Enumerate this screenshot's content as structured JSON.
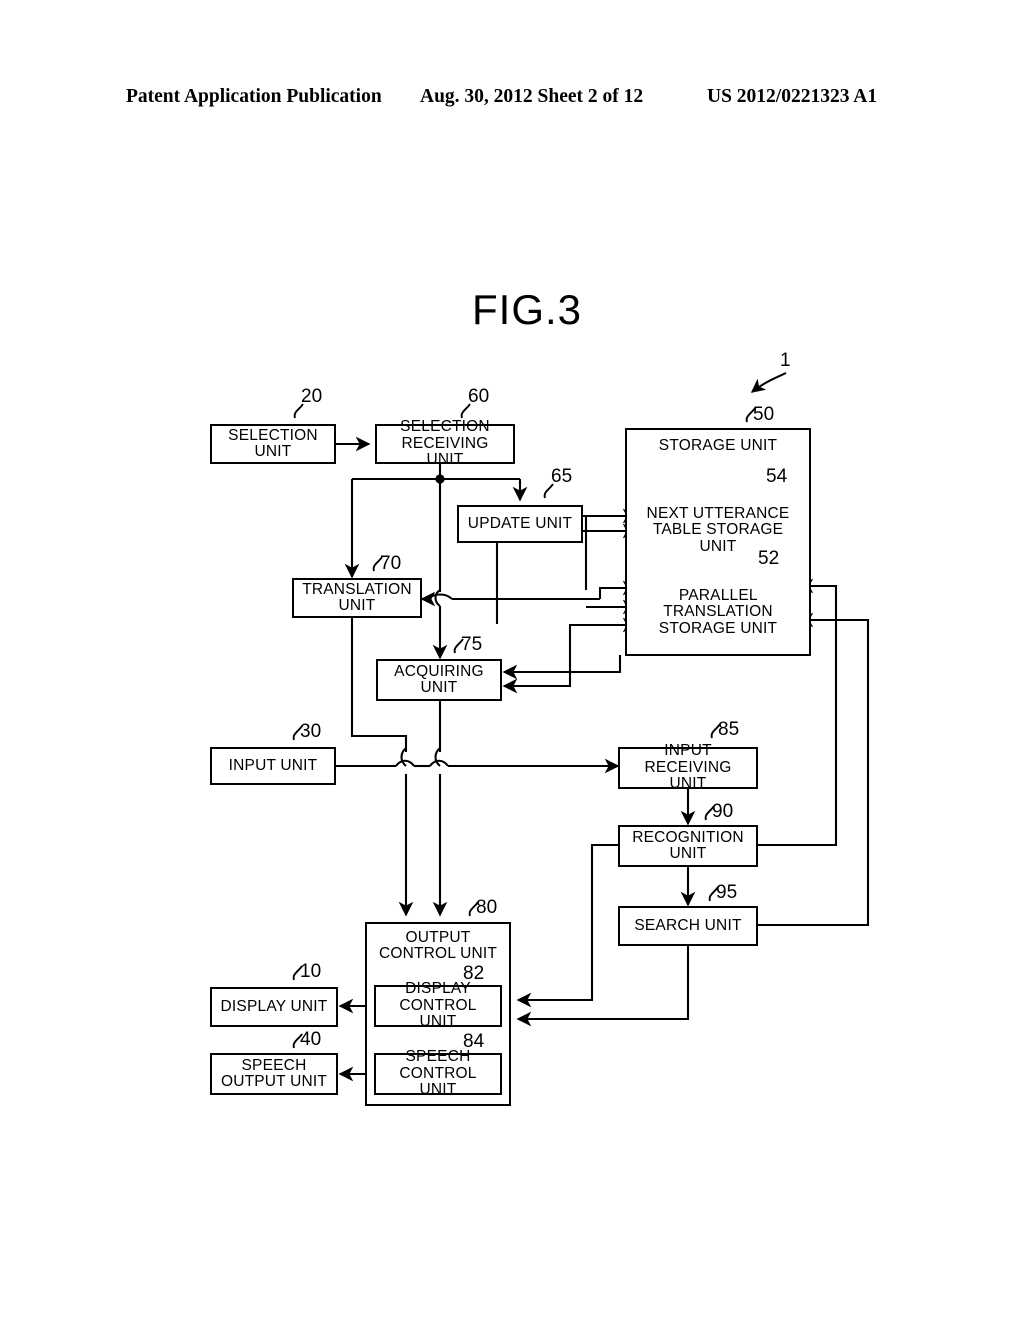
{
  "header": {
    "publication": "Patent Application Publication",
    "date_sheet": "Aug. 30, 2012  Sheet 2 of 12",
    "patent_number": "US 2012/0221323 A1"
  },
  "figure": {
    "title": "FIG.3",
    "system_ref": "1"
  },
  "nodes": [
    {
      "id": "selection_unit",
      "label": "SELECTION\nUNIT",
      "ref": "20"
    },
    {
      "id": "selection_receiving_unit",
      "label": "SELECTION\nRECEIVING UNIT",
      "ref": "60"
    },
    {
      "id": "update_unit",
      "label": "UPDATE UNIT",
      "ref": "65"
    },
    {
      "id": "storage_unit",
      "label": "STORAGE UNIT",
      "ref": "50"
    },
    {
      "id": "next_utterance_table",
      "label": "NEXT UTTERANCE\nTABLE STORAGE\nUNIT",
      "ref": "54"
    },
    {
      "id": "parallel_translation",
      "label": "PARALLEL\nTRANSLATION\nSTORAGE UNIT",
      "ref": "52"
    },
    {
      "id": "translation_unit",
      "label": "TRANSLATION\nUNIT",
      "ref": "70"
    },
    {
      "id": "acquiring_unit",
      "label": "ACQUIRING\nUNIT",
      "ref": "75"
    },
    {
      "id": "input_unit",
      "label": "INPUT UNIT",
      "ref": "30"
    },
    {
      "id": "input_receiving_unit",
      "label": "INPUT\nRECEIVING UNIT",
      "ref": "85"
    },
    {
      "id": "recognition_unit",
      "label": "RECOGNITION\nUNIT",
      "ref": "90"
    },
    {
      "id": "search_unit",
      "label": "SEARCH UNIT",
      "ref": "95"
    },
    {
      "id": "output_control_unit",
      "label": "OUTPUT\nCONTROL UNIT",
      "ref": "80"
    },
    {
      "id": "display_control_unit",
      "label": "DISPLAY\nCONTROL UNIT",
      "ref": "82"
    },
    {
      "id": "speech_control_unit",
      "label": "SPEECH\nCONTROL UNIT",
      "ref": "84"
    },
    {
      "id": "display_unit",
      "label": "DISPLAY UNIT",
      "ref": "10"
    },
    {
      "id": "speech_output_unit",
      "label": "SPEECH\nOUTPUT UNIT",
      "ref": "40"
    }
  ],
  "labels": {
    "selection_unit": "SELECTION\nUNIT",
    "selection_unit_l1": "SELECTION",
    "selection_unit_l2": "UNIT",
    "selection_receiving_l1": "SELECTION",
    "selection_receiving_l2": "RECEIVING UNIT",
    "update_unit": "UPDATE UNIT",
    "storage_unit": "STORAGE UNIT",
    "next_utterance_l1": "NEXT UTTERANCE",
    "next_utterance_l2": "TABLE STORAGE",
    "next_utterance_l3": "UNIT",
    "parallel_l1": "PARALLEL",
    "parallel_l2": "TRANSLATION",
    "parallel_l3": "STORAGE UNIT",
    "translation_l1": "TRANSLATION",
    "translation_l2": "UNIT",
    "acquiring_l1": "ACQUIRING",
    "acquiring_l2": "UNIT",
    "input_unit": "INPUT UNIT",
    "input_receiving_l1": "INPUT",
    "input_receiving_l2": "RECEIVING UNIT",
    "recognition_l1": "RECOGNITION",
    "recognition_l2": "UNIT",
    "search_unit": "SEARCH UNIT",
    "output_control_l1": "OUTPUT",
    "output_control_l2": "CONTROL UNIT",
    "display_control_l1": "DISPLAY",
    "display_control_l2": "CONTROL UNIT",
    "speech_control_l1": "SPEECH",
    "speech_control_l2": "CONTROL UNIT",
    "display_unit": "DISPLAY UNIT",
    "speech_output_l1": "SPEECH",
    "speech_output_l2": "OUTPUT UNIT"
  },
  "refs": {
    "r1": "1",
    "r10": "10",
    "r20": "20",
    "r30": "30",
    "r40": "40",
    "r50": "50",
    "r52": "52",
    "r54": "54",
    "r60": "60",
    "r65": "65",
    "r70": "70",
    "r75": "75",
    "r80": "80",
    "r82": "82",
    "r84": "84",
    "r85": "85",
    "r90": "90",
    "r95": "95"
  },
  "colors": {
    "ink": "#000000",
    "paper": "#ffffff"
  }
}
